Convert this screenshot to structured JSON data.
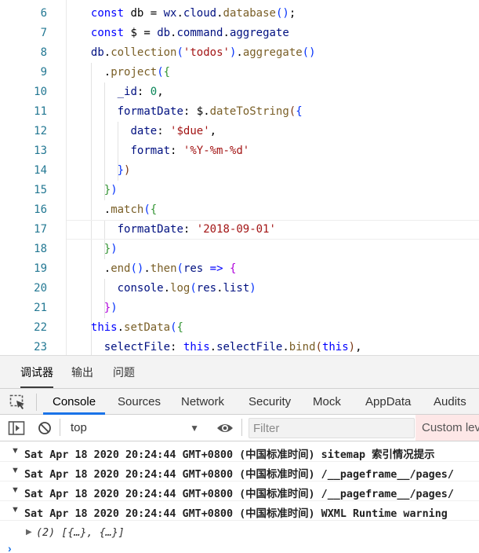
{
  "editor": {
    "lines": [
      {
        "num": "6",
        "tokens": [
          [
            "kw",
            "const "
          ],
          [
            "tx",
            "db = "
          ],
          [
            "id",
            "wx"
          ],
          [
            "tx",
            "."
          ],
          [
            "id",
            "cloud"
          ],
          [
            "tx",
            "."
          ],
          [
            "fn",
            "database"
          ],
          [
            "br1",
            "()"
          ],
          [
            "tx",
            ";"
          ]
        ]
      },
      {
        "num": "7",
        "tokens": [
          [
            "kw",
            "const "
          ],
          [
            "tx",
            "$ = "
          ],
          [
            "id",
            "db"
          ],
          [
            "tx",
            "."
          ],
          [
            "id",
            "command"
          ],
          [
            "tx",
            "."
          ],
          [
            "id",
            "aggregate"
          ]
        ]
      },
      {
        "num": "8",
        "tokens": [
          [
            "id",
            "db"
          ],
          [
            "tx",
            "."
          ],
          [
            "fn",
            "collection"
          ],
          [
            "br1",
            "("
          ],
          [
            "str",
            "'todos'"
          ],
          [
            "br1",
            ")"
          ],
          [
            "tx",
            "."
          ],
          [
            "fn",
            "aggregate"
          ],
          [
            "br1",
            "()"
          ]
        ]
      },
      {
        "num": "9",
        "tokens": [
          [
            "tx",
            "  ."
          ],
          [
            "fn",
            "project"
          ],
          [
            "br1",
            "("
          ],
          [
            "br2",
            "{"
          ]
        ]
      },
      {
        "num": "10",
        "tokens": [
          [
            "tx",
            "    "
          ],
          [
            "id",
            "_id"
          ],
          [
            "tx",
            ": "
          ],
          [
            "num",
            "0"
          ],
          [
            "tx",
            ","
          ]
        ]
      },
      {
        "num": "11",
        "tokens": [
          [
            "tx",
            "    "
          ],
          [
            "id",
            "formatDate"
          ],
          [
            "tx",
            ": $."
          ],
          [
            "fn",
            "dateToString"
          ],
          [
            "br3",
            "("
          ],
          [
            "br1",
            "{"
          ]
        ]
      },
      {
        "num": "12",
        "tokens": [
          [
            "tx",
            "      "
          ],
          [
            "id",
            "date"
          ],
          [
            "tx",
            ": "
          ],
          [
            "str",
            "'$due'"
          ],
          [
            "tx",
            ","
          ]
        ]
      },
      {
        "num": "13",
        "tokens": [
          [
            "tx",
            "      "
          ],
          [
            "id",
            "format"
          ],
          [
            "tx",
            ": "
          ],
          [
            "str",
            "'%Y-%m-%d'"
          ]
        ]
      },
      {
        "num": "14",
        "tokens": [
          [
            "tx",
            "    "
          ],
          [
            "br1",
            "}"
          ],
          [
            "br3",
            ")"
          ]
        ]
      },
      {
        "num": "15",
        "tokens": [
          [
            "tx",
            "  "
          ],
          [
            "br2",
            "}"
          ],
          [
            "br1",
            ")"
          ]
        ]
      },
      {
        "num": "16",
        "tokens": [
          [
            "tx",
            "  ."
          ],
          [
            "fn",
            "match"
          ],
          [
            "br1",
            "("
          ],
          [
            "br2",
            "{"
          ]
        ]
      },
      {
        "num": "17",
        "tokens": [
          [
            "tx",
            "    "
          ],
          [
            "id",
            "formatDate"
          ],
          [
            "tx",
            ": "
          ],
          [
            "str",
            "'2018-09-01'"
          ]
        ]
      },
      {
        "num": "18",
        "tokens": [
          [
            "tx",
            "  "
          ],
          [
            "br2",
            "}"
          ],
          [
            "br1",
            ")"
          ]
        ]
      },
      {
        "num": "19",
        "tokens": [
          [
            "tx",
            "  ."
          ],
          [
            "fn",
            "end"
          ],
          [
            "br1",
            "()"
          ],
          [
            "tx",
            "."
          ],
          [
            "fn",
            "then"
          ],
          [
            "br1",
            "("
          ],
          [
            "id",
            "res"
          ],
          [
            "tx",
            " "
          ],
          [
            "kw",
            "=>"
          ],
          [
            "tx",
            " "
          ],
          [
            "mag",
            "{"
          ]
        ]
      },
      {
        "num": "20",
        "tokens": [
          [
            "tx",
            "    "
          ],
          [
            "id",
            "console"
          ],
          [
            "tx",
            "."
          ],
          [
            "fn",
            "log"
          ],
          [
            "br1",
            "("
          ],
          [
            "id",
            "res"
          ],
          [
            "tx",
            "."
          ],
          [
            "id",
            "list"
          ],
          [
            "br1",
            ")"
          ]
        ]
      },
      {
        "num": "21",
        "tokens": [
          [
            "tx",
            "  "
          ],
          [
            "mag",
            "}"
          ],
          [
            "br1",
            ")"
          ]
        ]
      },
      {
        "num": "22",
        "tokens": [
          [
            "kw",
            "this"
          ],
          [
            "tx",
            "."
          ],
          [
            "fn",
            "setData"
          ],
          [
            "br1",
            "("
          ],
          [
            "br2",
            "{"
          ]
        ]
      },
      {
        "num": "23",
        "tokens": [
          [
            "tx",
            "  "
          ],
          [
            "id",
            "selectFile"
          ],
          [
            "tx",
            ": "
          ],
          [
            "kw",
            "this"
          ],
          [
            "tx",
            "."
          ],
          [
            "id",
            "selectFile"
          ],
          [
            "tx",
            "."
          ],
          [
            "fn",
            "bind"
          ],
          [
            "br3",
            "("
          ],
          [
            "kw",
            "this"
          ],
          [
            "br3",
            ")"
          ],
          [
            "tx",
            ","
          ]
        ]
      }
    ]
  },
  "panel_tabs": [
    "调试器",
    "输出",
    "问题"
  ],
  "devtools": {
    "tabs": [
      "Console",
      "Sources",
      "Network",
      "Security",
      "Mock",
      "AppData",
      "Audits"
    ],
    "active_tab": "Console"
  },
  "filter_bar": {
    "context": "top",
    "filter_placeholder": "Filter",
    "levels_label": "Custom lev"
  },
  "console": {
    "messages": [
      "Sat Apr 18 2020 20:24:44 GMT+0800 (中国标准时间) sitemap 索引情况提示",
      "Sat Apr 18 2020 20:24:44 GMT+0800 (中国标准时间) /__pageframe__/pages/",
      "Sat Apr 18 2020 20:24:44 GMT+0800 (中国标准时间) /__pageframe__/pages/",
      "Sat Apr 18 2020 20:24:44 GMT+0800 (中国标准时间) WXML Runtime warning"
    ],
    "result": "(2) [{…}, {…}]",
    "prompt": "›"
  },
  "colors": {
    "accent": "#1a73e8",
    "line_number": "#237893",
    "levels_bg": "#fde7e7"
  }
}
